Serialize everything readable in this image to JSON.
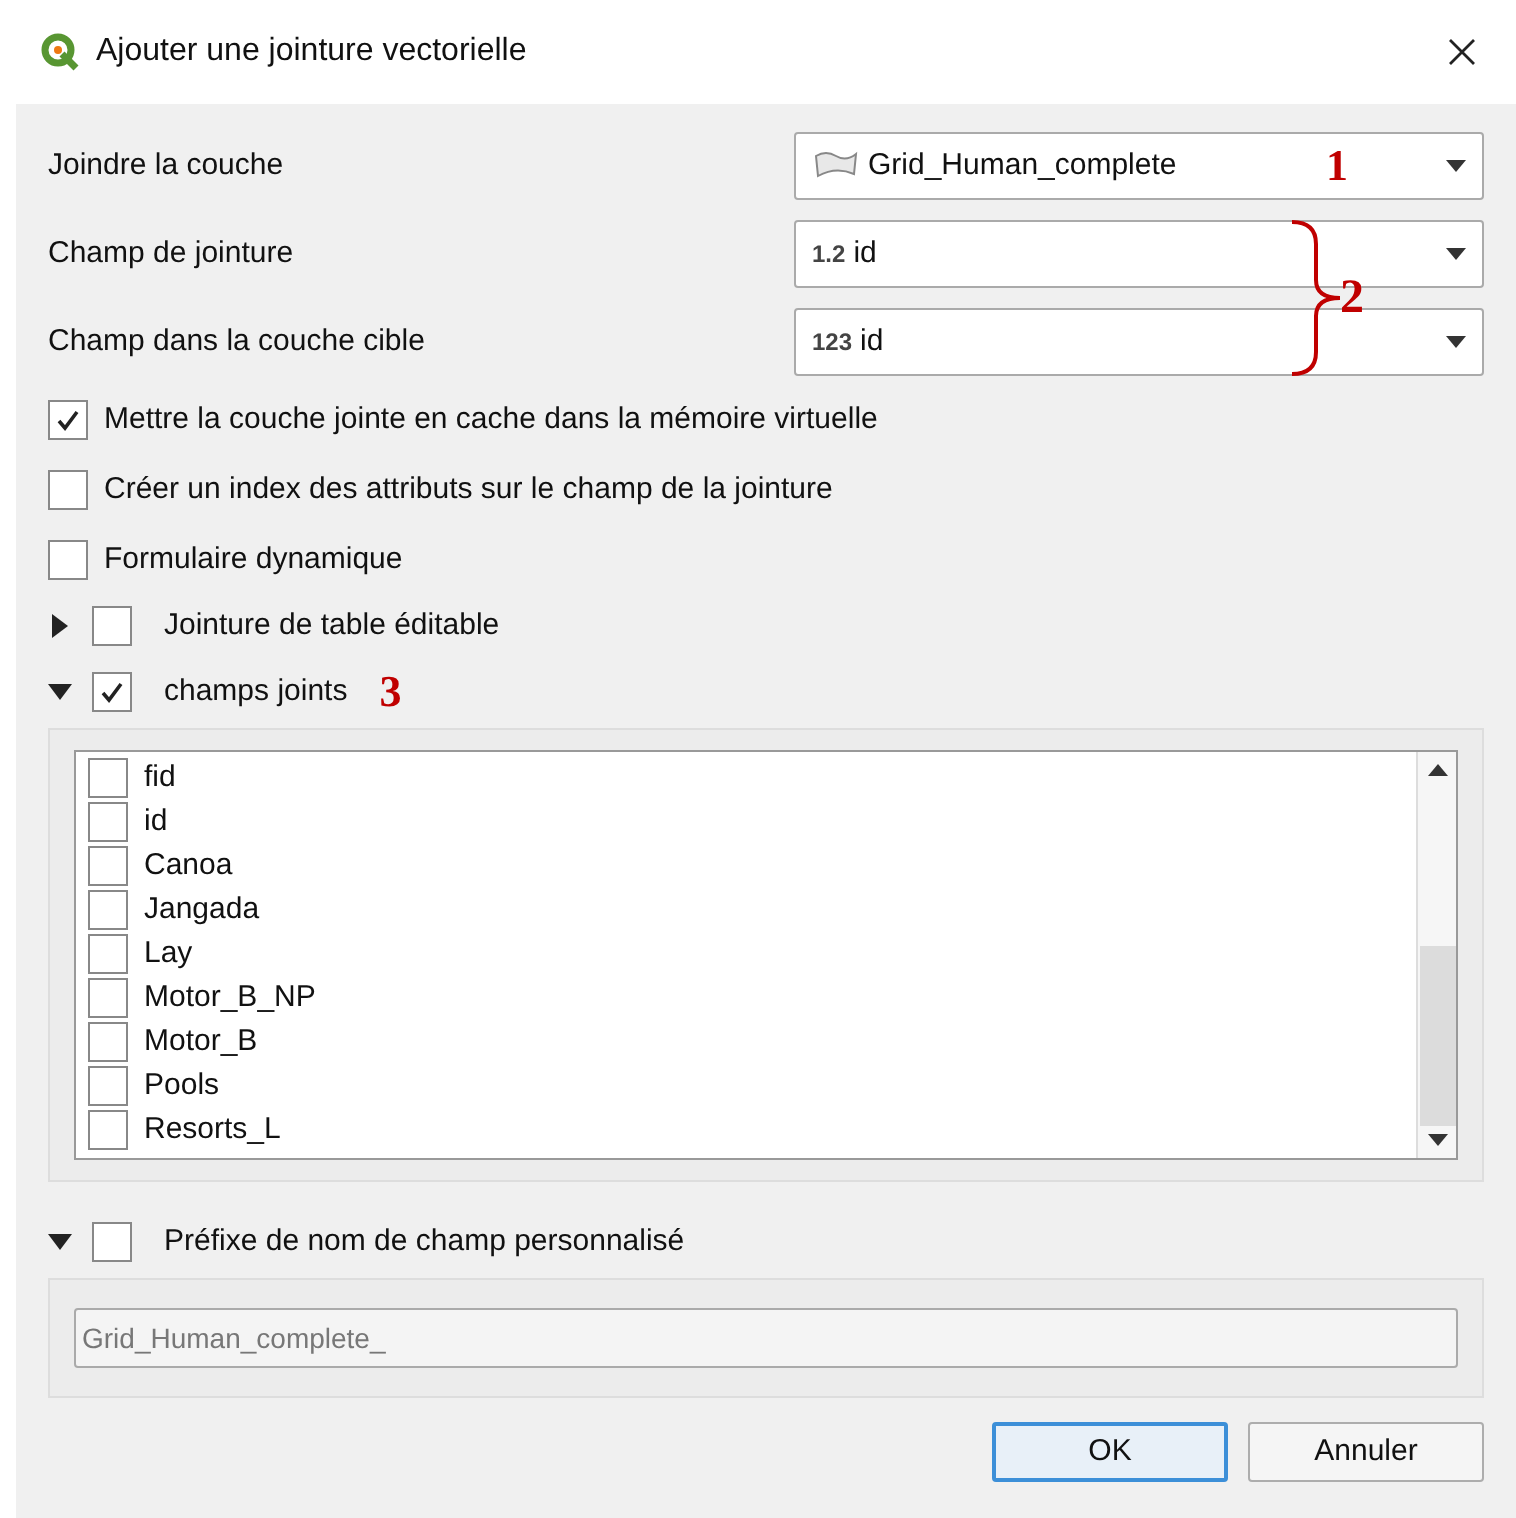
{
  "window": {
    "title": "Ajouter une jointure vectorielle"
  },
  "combos": [
    {
      "label": "Joindre la couche",
      "kind": "layer",
      "value": "Grid_Human_complete",
      "annotation": "1"
    },
    {
      "label": "Champ de jointure",
      "kind": "field",
      "type_label": "1.2",
      "value": "id"
    },
    {
      "label": "Champ dans la couche cible",
      "kind": "field",
      "type_label": "123",
      "value": "id"
    }
  ],
  "combo_group_annotation": "2",
  "options": [
    {
      "label": "Mettre la couche jointe en cache dans la mémoire virtuelle",
      "checked": true
    },
    {
      "label": "Créer un index des attributs sur le champ de la jointure",
      "checked": false
    },
    {
      "label": "Formulaire dynamique",
      "checked": false
    }
  ],
  "editable_join": {
    "label": "Jointure de table éditable",
    "checked": false,
    "expanded": false
  },
  "joined_fields": {
    "label": "champs joints",
    "checked": true,
    "expanded": true,
    "annotation": "3",
    "fields": [
      {
        "name": "fid",
        "checked": false
      },
      {
        "name": "id",
        "checked": false
      },
      {
        "name": "Canoa",
        "checked": false
      },
      {
        "name": "Jangada",
        "checked": false
      },
      {
        "name": "Lay",
        "checked": false
      },
      {
        "name": "Motor_B_NP",
        "checked": false
      },
      {
        "name": "Motor_B",
        "checked": false
      },
      {
        "name": "Pools",
        "checked": false
      },
      {
        "name": "Resorts_L",
        "checked": false
      }
    ]
  },
  "prefix": {
    "label": "Préfixe de nom de champ personnalisé",
    "checked": false,
    "expanded": true,
    "value": "Grid_Human_complete_"
  },
  "buttons": [
    {
      "label": "OK",
      "default": true
    },
    {
      "label": "Annuler",
      "default": false
    }
  ]
}
